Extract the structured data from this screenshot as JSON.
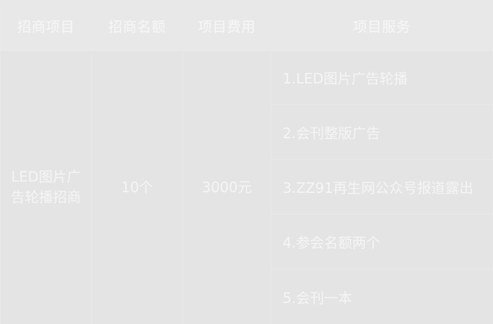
{
  "header": {
    "col1": "招商项目",
    "col2": "招商名额",
    "col3": "项目费用",
    "col4": "项目服务"
  },
  "row": {
    "project": "LED图片广告轮播招商",
    "quota": "10个",
    "fee": "3000元",
    "services": [
      "1.LED图片广告轮播",
      "2.会刊整版广告",
      "3.ZZ91再生网公众号报道露出",
      "4.参会名额两个",
      "5.会刊一本"
    ]
  },
  "colors": {
    "header_bg": "#e8e8e8",
    "body_bg": "#e4e4e4",
    "text": "#f5f5f5",
    "border": "#e9e9e9"
  }
}
